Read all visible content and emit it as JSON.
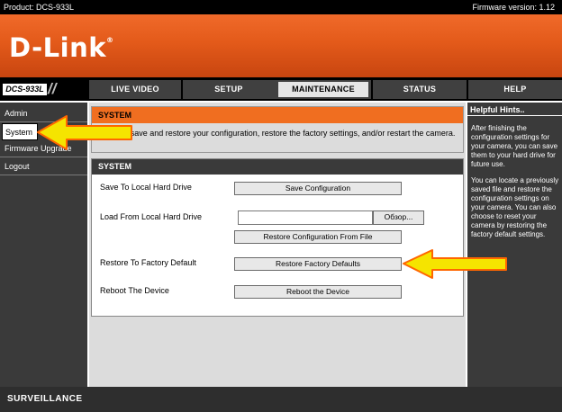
{
  "header": {
    "product": "Product: DCS-933L",
    "firmware": "Firmware version: 1.12"
  },
  "brand": {
    "logo": "D-Link",
    "reg": "®"
  },
  "nav": {
    "model": "DCS-933L",
    "tabs": [
      "LIVE VIDEO",
      "SETUP",
      "MAINTENANCE",
      "STATUS",
      "HELP"
    ],
    "active_tab": "MAINTENANCE"
  },
  "sidebar": {
    "items": [
      "Admin",
      "System",
      "Firmware Upgrade",
      "Logout"
    ],
    "active": "System"
  },
  "intro": {
    "title": "SYSTEM",
    "text": "You can save and restore your configuration, restore the factory settings, and/or restart the camera."
  },
  "system": {
    "title": "SYSTEM",
    "rows": [
      {
        "label": "Save To Local Hard Drive",
        "button": "Save Configuration"
      },
      {
        "label": "Load From Local Hard Drive",
        "browse": "Обзор...",
        "button": "Restore Configuration From File"
      },
      {
        "label": "Restore To Factory Default",
        "button": "Restore Factory Defaults"
      },
      {
        "label": "Reboot The Device",
        "button": "Reboot the Device"
      }
    ]
  },
  "hints": {
    "title": "Helpful Hints..",
    "paragraphs": [
      "After finishing the configuration settings for your camera, you can save them to your hard drive for future use.",
      "You can locate a previously saved file and restore the configuration settings on your camera. You can also choose to reset your camera by restoring the factory default settings."
    ]
  },
  "footer": {
    "text": "SURVEILLANCE"
  },
  "colors": {
    "brand_orange": "#e35a1a",
    "section_orange": "#f06e20",
    "arrow_fill": "#f5e400",
    "arrow_stroke": "#ff6600"
  }
}
